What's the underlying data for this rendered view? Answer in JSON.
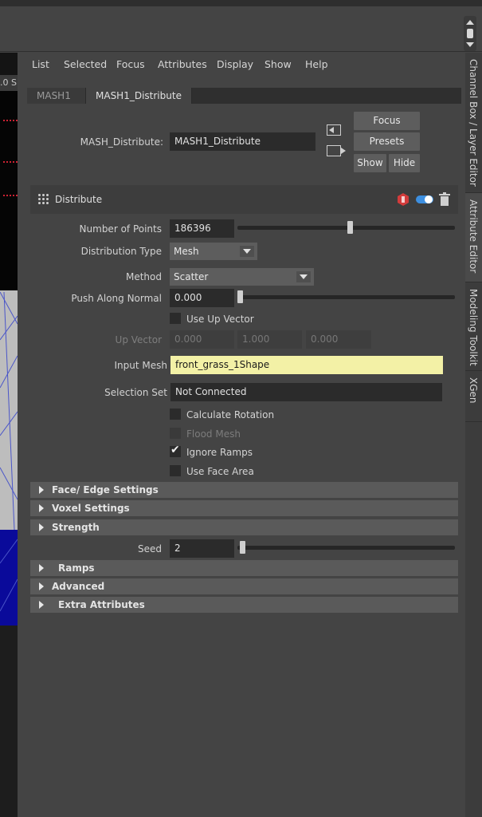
{
  "viewport": {
    "label": ".0 S"
  },
  "menu": [
    "List",
    "Selected",
    "Focus",
    "Attributes",
    "Display",
    "Show",
    "Help"
  ],
  "tabs": [
    "MASH1",
    "MASH1_Distribute"
  ],
  "node": {
    "label": "MASH_Distribute:",
    "name": "MASH1_Distribute"
  },
  "buttons": {
    "focus": "Focus",
    "presets": "Presets",
    "show": "Show",
    "hide": "Hide"
  },
  "distribute": {
    "title": "Distribute",
    "number_of_points_label": "Number of Points",
    "number_of_points": "186396",
    "number_of_points_slider": 0.52,
    "distribution_type_label": "Distribution Type",
    "distribution_type": "Mesh",
    "method_label": "Method",
    "method": "Scatter",
    "push_along_normal_label": "Push Along Normal",
    "push_along_normal": "0.000",
    "push_slider": 0.0,
    "use_up_vector": "Use Up Vector",
    "up_vector_label": "Up Vector",
    "up_vector": [
      "0.000",
      "1.000",
      "0.000"
    ],
    "input_mesh_label": "Input Mesh",
    "input_mesh": "front_grass_1Shape",
    "selection_set_label": "Selection Set",
    "selection_set": "Not Connected",
    "calculate_rotation": "Calculate Rotation",
    "flood_mesh": "Flood Mesh",
    "ignore_ramps": "Ignore Ramps",
    "use_face_area": "Use Face Area",
    "seed_label": "Seed",
    "seed": "2",
    "seed_slider": 0.01
  },
  "frames": {
    "face_edge": "Face/ Edge Settings",
    "voxel": "Voxel Settings",
    "strength": "Strength",
    "ramps": "Ramps",
    "advanced": "Advanced",
    "extra": "Extra Attributes"
  },
  "side_tabs": [
    "Channel Box / Layer Editor",
    "Attribute Editor",
    "Modeling Toolkit",
    "XGen"
  ],
  "colors": {
    "input_mesh_bg": "#f3f1a6",
    "accent_blue": "#3d8fe0",
    "warn_red": "#d33b3b"
  }
}
